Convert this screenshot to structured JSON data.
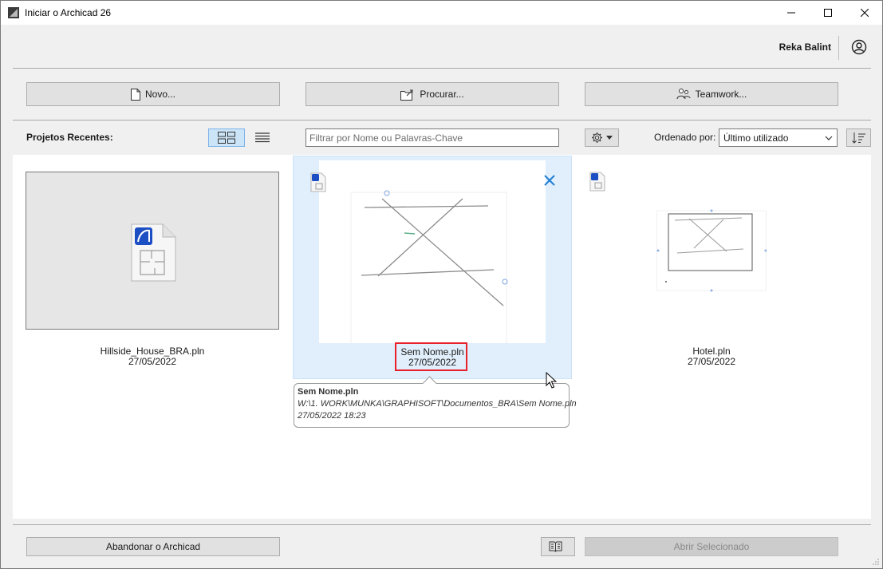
{
  "window": {
    "title": "Iniciar o Archicad 26"
  },
  "user": {
    "name": "Reka Balint",
    "icon": "user-circle-icon"
  },
  "actions": {
    "new": "Novo...",
    "browse": "Procurar...",
    "teamwork": "Teamwork..."
  },
  "recent": {
    "label": "Projetos Recentes:",
    "filter_placeholder": "Filtrar por Nome ou Palavras-Chave",
    "sort_label": "Ordenado por:",
    "sort_value": "Último utilizado"
  },
  "projects": [
    {
      "name": "Hillside_House_BRA.pln",
      "date": "27/05/2022"
    },
    {
      "name": "Sem Nome.pln",
      "date": "27/05/2022",
      "selected": true
    },
    {
      "name": "Hotel.pln",
      "date": "27/05/2022"
    }
  ],
  "tooltip": {
    "name": "Sem Nome.pln",
    "path": "W:\\1. WORK\\MUNKA\\GRAPHISOFT\\Documentos_BRA\\Sem Nome.pln",
    "timestamp": "27/05/2022 18:23"
  },
  "footer": {
    "quit": "Abandonar o Archicad",
    "open_selected": "Abrir Selecionado"
  },
  "colors": {
    "selection": "#e1effc",
    "highlight": "#e8202a",
    "remove_x": "#1e7fd6",
    "view_active": "#cce4f7"
  }
}
